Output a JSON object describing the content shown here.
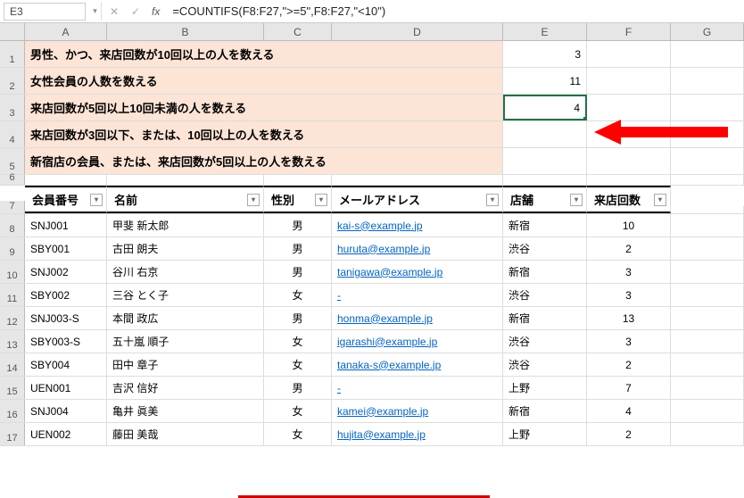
{
  "name_box": "E3",
  "formula": "=COUNTIFS(F8:F27,\">=5\",F8:F27,\"<10\")",
  "fx": "fx",
  "columns": [
    "A",
    "B",
    "C",
    "D",
    "E",
    "F",
    "G"
  ],
  "desc_rows": [
    {
      "n": "1",
      "text": "男性、かつ、来店回数が10回以上の人を数える",
      "val": "3"
    },
    {
      "n": "2",
      "text": "女性会員の人数を数える",
      "val": "11"
    },
    {
      "n": "3",
      "text": "来店回数が5回以上10回未満の人を数える",
      "val": "4"
    },
    {
      "n": "4",
      "text": "来店回数が3回以下、または、10回以上の人を数える",
      "val": ""
    },
    {
      "n": "5",
      "text": "新宿店の会員、または、来店回数が5回以上の人を数える",
      "val": ""
    }
  ],
  "row6": "6",
  "table_headers": {
    "n": "7",
    "cols": [
      "会員番号",
      "名前",
      "性別",
      "メールアドレス",
      "店舗",
      "来店回数"
    ]
  },
  "data_rows": [
    {
      "n": "8",
      "id": "SNJ001",
      "name": "甲斐 新太郎",
      "sex": "男",
      "mail": "kai-s@example.jp",
      "store": "新宿",
      "visits": "10"
    },
    {
      "n": "9",
      "id": "SBY001",
      "name": "古田 朗夫",
      "sex": "男",
      "mail": "huruta@example.jp",
      "store": "渋谷",
      "visits": "2"
    },
    {
      "n": "10",
      "id": "SNJ002",
      "name": "谷川 右京",
      "sex": "男",
      "mail": "tanigawa@example.jp",
      "store": "新宿",
      "visits": "3"
    },
    {
      "n": "11",
      "id": "SBY002",
      "name": "三谷 とく子",
      "sex": "女",
      "mail": "-",
      "store": "渋谷",
      "visits": "3"
    },
    {
      "n": "12",
      "id": "SNJ003-S",
      "name": "本間 政広",
      "sex": "男",
      "mail": "honma@example.jp",
      "store": "新宿",
      "visits": "13"
    },
    {
      "n": "13",
      "id": "SBY003-S",
      "name": "五十嵐 順子",
      "sex": "女",
      "mail": "igarashi@example.jp",
      "store": "渋谷",
      "visits": "3"
    },
    {
      "n": "14",
      "id": "SBY004",
      "name": "田中 章子",
      "sex": "女",
      "mail": "tanaka-s@example.jp",
      "store": "渋谷",
      "visits": "2"
    },
    {
      "n": "15",
      "id": "UEN001",
      "name": "吉沢 信好",
      "sex": "男",
      "mail": "-",
      "store": "上野",
      "visits": "7"
    },
    {
      "n": "16",
      "id": "SNJ004",
      "name": "亀井 眞美",
      "sex": "女",
      "mail": "kamei@example.jp",
      "store": "新宿",
      "visits": "4"
    },
    {
      "n": "17",
      "id": "UEN002",
      "name": "藤田 美哉",
      "sex": "女",
      "mail": "hujita@example.jp",
      "store": "上野",
      "visits": "2"
    }
  ]
}
